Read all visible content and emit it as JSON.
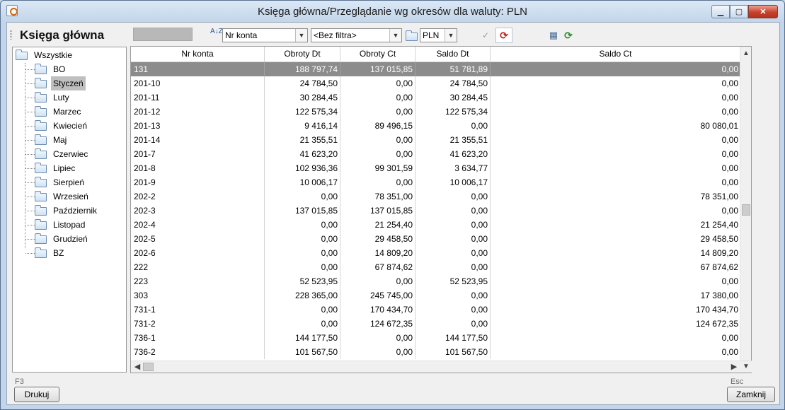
{
  "window": {
    "title": "Księga główna/Przeglądanie wg okresów dla waluty: PLN",
    "controls": {
      "minimize": "▁",
      "maximize": "▢",
      "close": "✕"
    }
  },
  "toolbar": {
    "module_title": "Księga główna",
    "sort_field": "Nr konta",
    "filter": "<Bez filtra>",
    "currency": "PLN",
    "combo_arrow": "▼",
    "sort_icon_text": "A↓Z"
  },
  "tree": {
    "root": "Wszystkie",
    "items": [
      "BO",
      "Styczeń",
      "Luty",
      "Marzec",
      "Kwiecień",
      "Maj",
      "Czerwiec",
      "Lipiec",
      "Sierpień",
      "Wrzesień",
      "Październik",
      "Listopad",
      "Grudzień",
      "BZ"
    ],
    "selected": "Styczeń"
  },
  "grid": {
    "columns": [
      "Nr konta",
      "Obroty Dt",
      "Obroty Ct",
      "Saldo Dt",
      "Saldo Ct"
    ],
    "rows": [
      [
        "131",
        "188 797,74",
        "137 015,85",
        "51 781,89",
        "0,00"
      ],
      [
        "201-10",
        "24 784,50",
        "0,00",
        "24 784,50",
        "0,00"
      ],
      [
        "201-11",
        "30 284,45",
        "0,00",
        "30 284,45",
        "0,00"
      ],
      [
        "201-12",
        "122 575,34",
        "0,00",
        "122 575,34",
        "0,00"
      ],
      [
        "201-13",
        "9 416,14",
        "89 496,15",
        "0,00",
        "80 080,01"
      ],
      [
        "201-14",
        "21 355,51",
        "0,00",
        "21 355,51",
        "0,00"
      ],
      [
        "201-7",
        "41 623,20",
        "0,00",
        "41 623,20",
        "0,00"
      ],
      [
        "201-8",
        "102 936,36",
        "99 301,59",
        "3 634,77",
        "0,00"
      ],
      [
        "201-9",
        "10 006,17",
        "0,00",
        "10 006,17",
        "0,00"
      ],
      [
        "202-2",
        "0,00",
        "78 351,00",
        "0,00",
        "78 351,00"
      ],
      [
        "202-3",
        "137 015,85",
        "137 015,85",
        "0,00",
        "0,00"
      ],
      [
        "202-4",
        "0,00",
        "21 254,40",
        "0,00",
        "21 254,40"
      ],
      [
        "202-5",
        "0,00",
        "29 458,50",
        "0,00",
        "29 458,50"
      ],
      [
        "202-6",
        "0,00",
        "14 809,20",
        "0,00",
        "14 809,20"
      ],
      [
        "222",
        "0,00",
        "67 874,62",
        "0,00",
        "67 874,62"
      ],
      [
        "223",
        "52 523,95",
        "0,00",
        "52 523,95",
        "0,00"
      ],
      [
        "303",
        "228 365,00",
        "245 745,00",
        "0,00",
        "17 380,00"
      ],
      [
        "731-1",
        "0,00",
        "170 434,70",
        "0,00",
        "170 434,70"
      ],
      [
        "731-2",
        "0,00",
        "124 672,35",
        "0,00",
        "124 672,35"
      ],
      [
        "736-1",
        "144 177,50",
        "0,00",
        "144 177,50",
        "0,00"
      ],
      [
        "736-2",
        "101 567,50",
        "0,00",
        "101 567,50",
        "0,00"
      ]
    ],
    "selected_row": 0
  },
  "footer": {
    "print_shortcut": "F3",
    "print_label": "Drukuj",
    "close_shortcut": "Esc",
    "close_label": "Zamknij"
  },
  "colors": {
    "selected_row_bg": "#8c8c8c",
    "tree_selected_bg": "#bfbfbf",
    "refresh_green": "#2f8f2f",
    "refresh_red": "#c2271c"
  }
}
